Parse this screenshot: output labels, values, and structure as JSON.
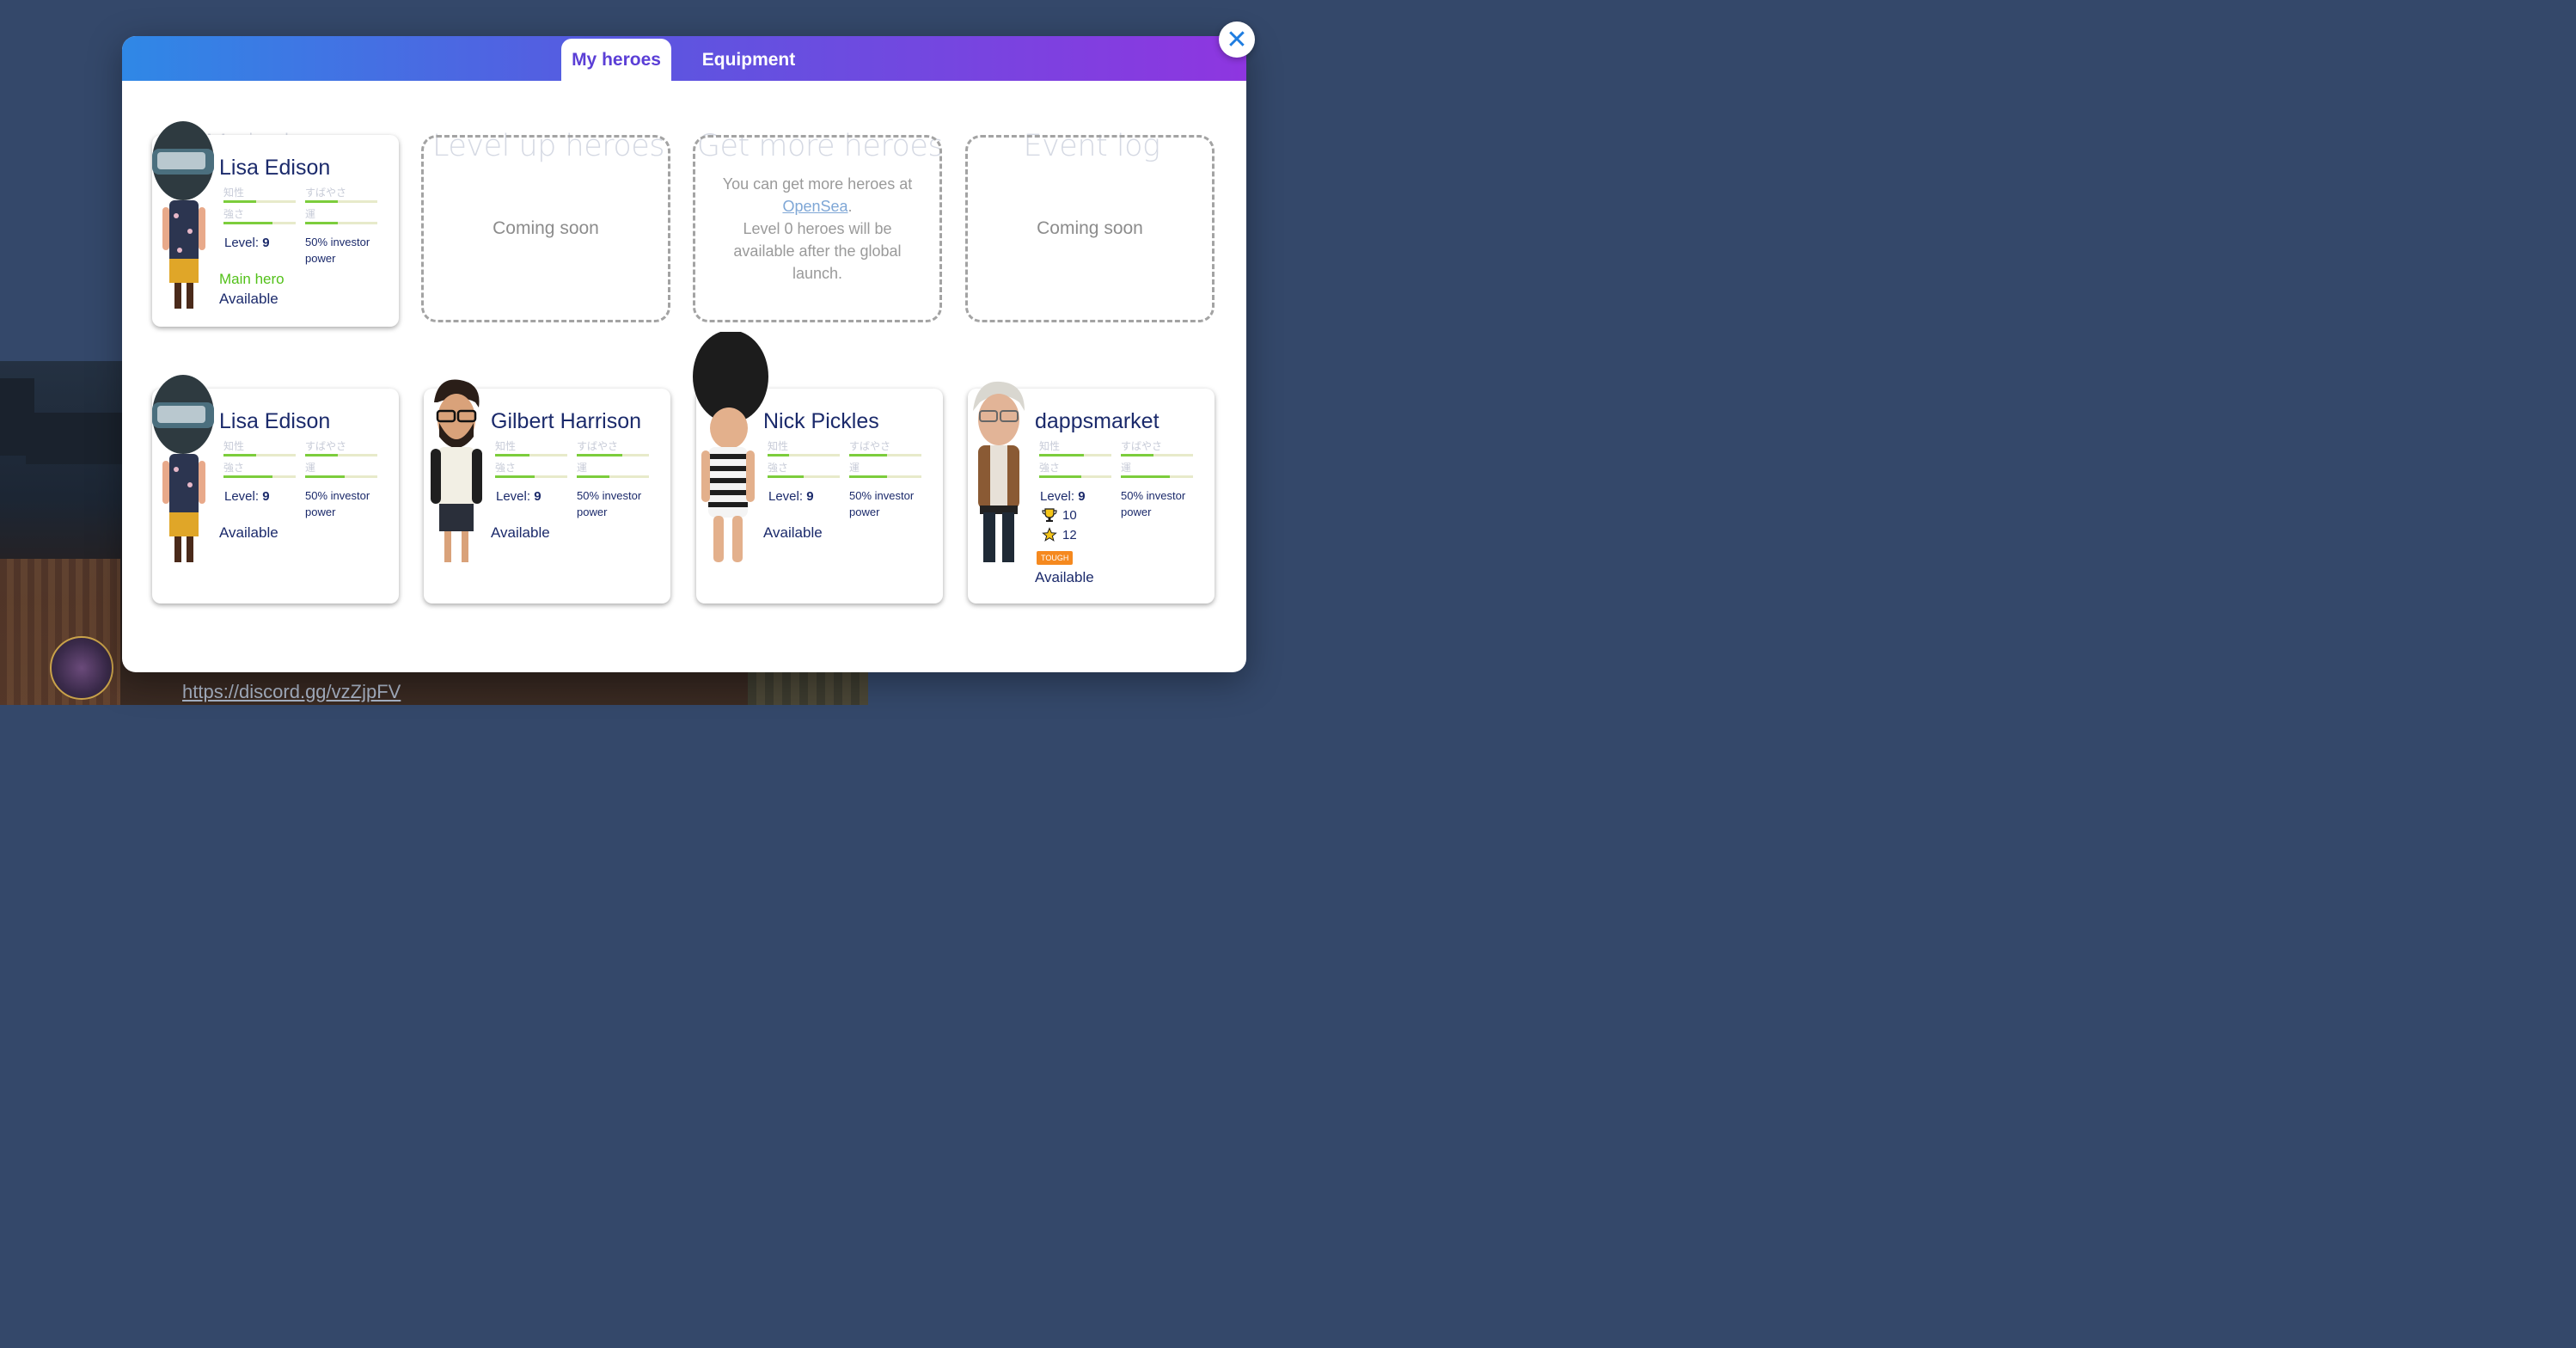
{
  "tabs": {
    "my_heroes": "My heroes",
    "equipment": "Equipment"
  },
  "sections": {
    "main_hero": "Main hero",
    "level_up": "Level up heroes",
    "get_more": "Get more heroes",
    "event_log": "Event log"
  },
  "placeholders": {
    "level_up": "Coming soon",
    "event_log": "Coming soon",
    "get_more_line1": "You can get more heroes at",
    "get_more_link": "OpenSea",
    "get_more_period": ".",
    "get_more_line2": "Level 0 heroes will be available after the global launch."
  },
  "stat_labels": {
    "intelligence": "知性",
    "speed": "すばやさ",
    "strength": "強さ",
    "luck": "運"
  },
  "common": {
    "level_label": "Level: ",
    "investor": "50% investor power",
    "available": "Available",
    "main_hero_tag": "Main hero"
  },
  "main_hero": {
    "name": "Lisa Edison",
    "level": "9",
    "stats": {
      "intelligence": 0.45,
      "speed": 0.45,
      "strength": 0.68,
      "luck": 0.45
    }
  },
  "heroes": [
    {
      "name": "Lisa Edison",
      "level": "9",
      "stats": {
        "intelligence": 0.45,
        "speed": 0.45,
        "strength": 0.68,
        "luck": 0.55
      }
    },
    {
      "name": "Gilbert Harrison",
      "level": "9",
      "stats": {
        "intelligence": 0.48,
        "speed": 0.63,
        "strength": 0.55,
        "luck": 0.45
      }
    },
    {
      "name": "Nick Pickles",
      "level": "9",
      "stats": {
        "intelligence": 0.3,
        "speed": 0.52,
        "strength": 0.5,
        "luck": 0.52
      }
    },
    {
      "name": "dappsmarket",
      "level": "9",
      "trophies": "10",
      "stars": "12",
      "badge": "TOUGH",
      "stats": {
        "intelligence": 0.62,
        "speed": 0.45,
        "strength": 0.58,
        "luck": 0.68
      }
    }
  ],
  "background": {
    "discord_link": "https://discord.gg/vzZjpFV"
  },
  "colors": {
    "accent": "#5b3fd6",
    "name_text": "#1b2a6b",
    "stat_bar": "#7ccd3c",
    "main_hero_label": "#53c11a",
    "badge": "#f5891f"
  }
}
